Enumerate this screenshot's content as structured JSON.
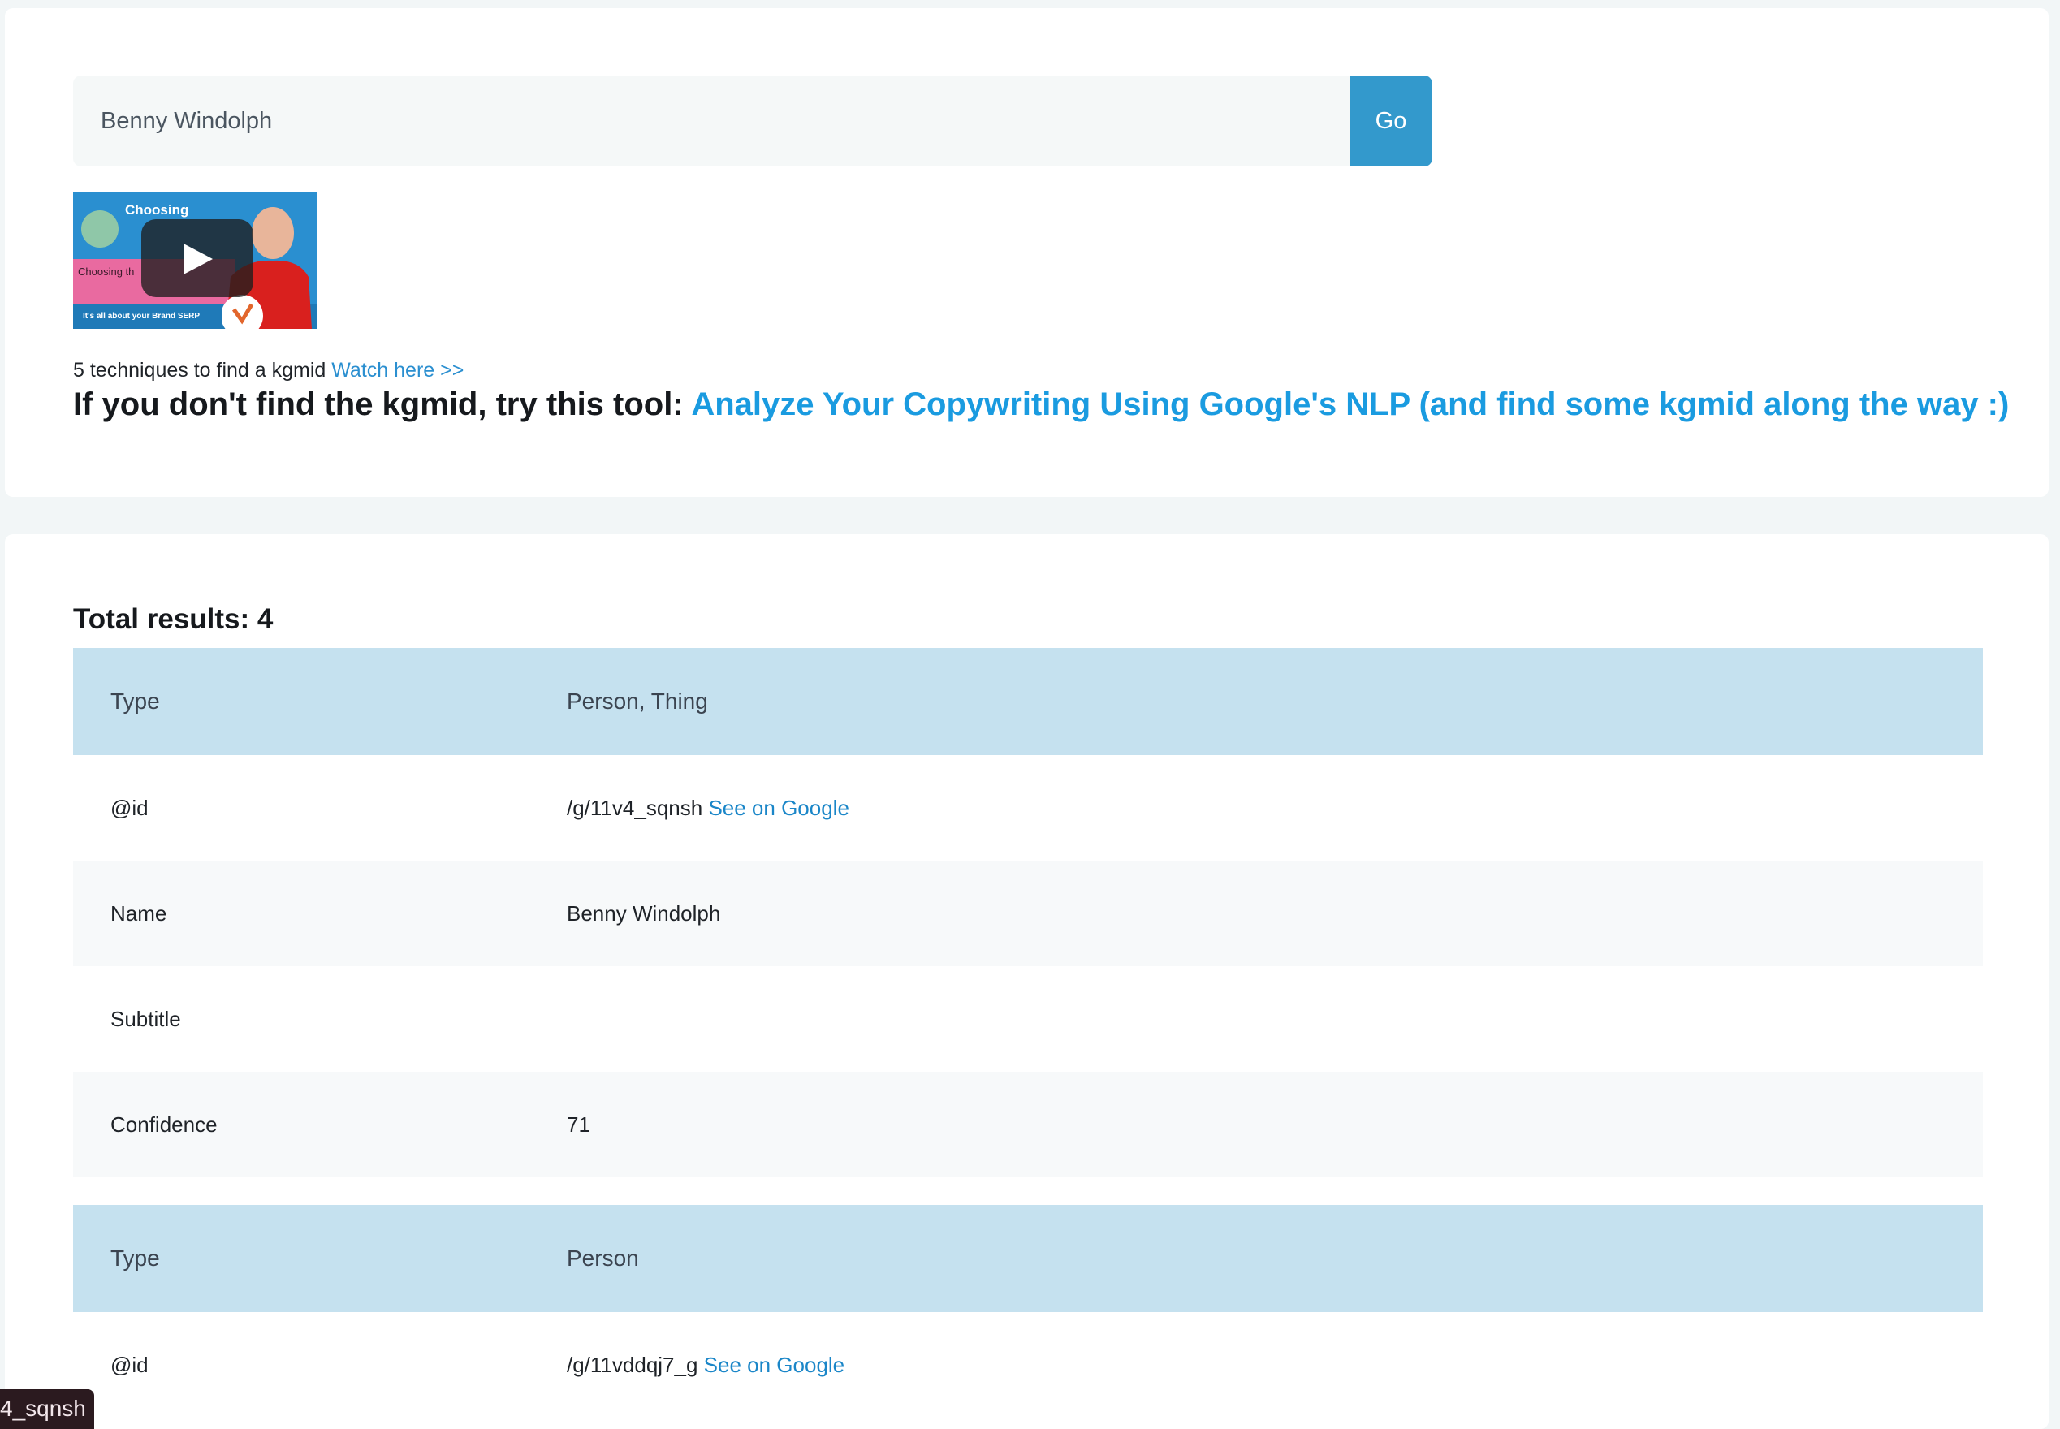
{
  "search": {
    "value": "Benny Windolph",
    "go_label": "Go"
  },
  "video": {
    "thumb_title": "Choosing",
    "thumb_subtitle": "Choosing th",
    "thumb_footer": "It's all about your Brand SERP"
  },
  "info": {
    "techniques_text": "5 techniques to find a kgmid",
    "watch_link": "Watch here >>",
    "tool_prefix": "If you don't find the kgmid, try this tool:",
    "tool_link": "Analyze Your Copywriting Using Google's NLP (and find some kgmid along the way :)"
  },
  "results": {
    "total_label": "Total results: 4",
    "items": [
      {
        "type_key": "Type",
        "type_value": "Person, Thing",
        "id_key": "@id",
        "id_value": "/g/11v4_sqnsh",
        "id_link": "See on Google",
        "name_key": "Name",
        "name_value": "Benny Windolph",
        "subtitle_key": "Subtitle",
        "subtitle_value": "",
        "confidence_key": "Confidence",
        "confidence_value": "71"
      },
      {
        "type_key": "Type",
        "type_value": "Person",
        "id_key": "@id",
        "id_value": "/g/11vddqj7_g",
        "id_link": "See on Google"
      }
    ]
  },
  "tooltip": {
    "text": "4_sqnsh"
  }
}
